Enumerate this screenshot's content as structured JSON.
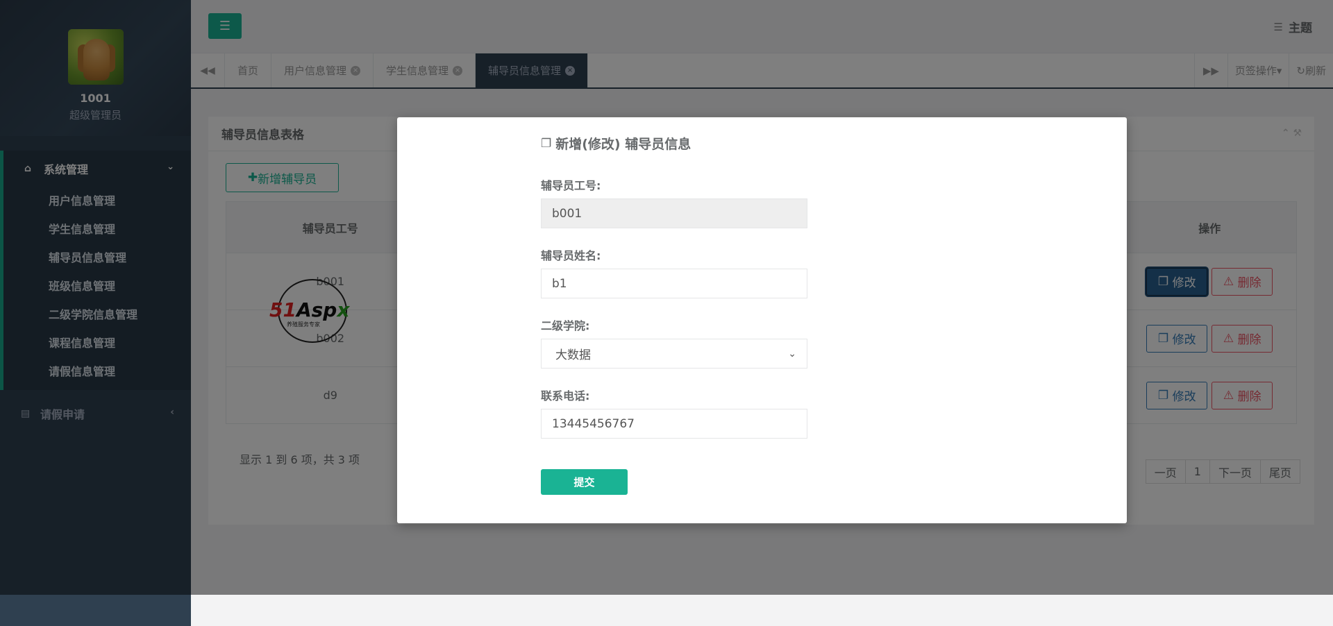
{
  "sidebar": {
    "username": "1001",
    "role": "超级管理员",
    "group_label": "系统管理",
    "items": [
      {
        "label": "用户信息管理"
      },
      {
        "label": "学生信息管理"
      },
      {
        "label": "辅导员信息管理"
      },
      {
        "label": "班级信息管理"
      },
      {
        "label": "二级学院信息管理"
      },
      {
        "label": "课程信息管理"
      },
      {
        "label": "请假信息管理"
      }
    ],
    "second_group_label": "请假申请"
  },
  "topbar": {
    "theme_label": "主题"
  },
  "tabs": {
    "items": [
      {
        "label": "首页"
      },
      {
        "label": "用户信息管理"
      },
      {
        "label": "学生信息管理"
      },
      {
        "label": "辅导员信息管理"
      }
    ],
    "tab_ops_label": "页签操作",
    "refresh_label": "刷新"
  },
  "panel": {
    "title": "辅导员信息表格",
    "add_label": "新增辅导员",
    "columns": [
      "辅导员工号",
      "操作"
    ],
    "rows": [
      {
        "id": "b001"
      },
      {
        "id": "b002"
      },
      {
        "id": "d9"
      }
    ],
    "edit_label": "修改",
    "delete_label": "删除",
    "pager_info": "显示 1 到 6 项，共 3 项",
    "pager": [
      "一页",
      "1",
      "下一页",
      "尾页"
    ]
  },
  "modal": {
    "title": "新增(修改) 辅导员信息",
    "fields": {
      "id_label": "辅导员工号:",
      "id_value": "b001",
      "name_label": "辅导员姓名:",
      "name_value": "b1",
      "college_label": "二级学院:",
      "college_value": "大数据",
      "phone_label": "联系电话:",
      "phone_value": "13445456767"
    },
    "submit_label": "提交"
  },
  "watermark": {
    "brand_a": "51",
    "brand_b": "Asp",
    "brand_c": "x",
    "sub": "养殖服务专家"
  },
  "colors": {
    "sidebar": "#2f4050",
    "accent": "#1ab394",
    "danger": "#ed5565",
    "primary": "#337ab7"
  }
}
